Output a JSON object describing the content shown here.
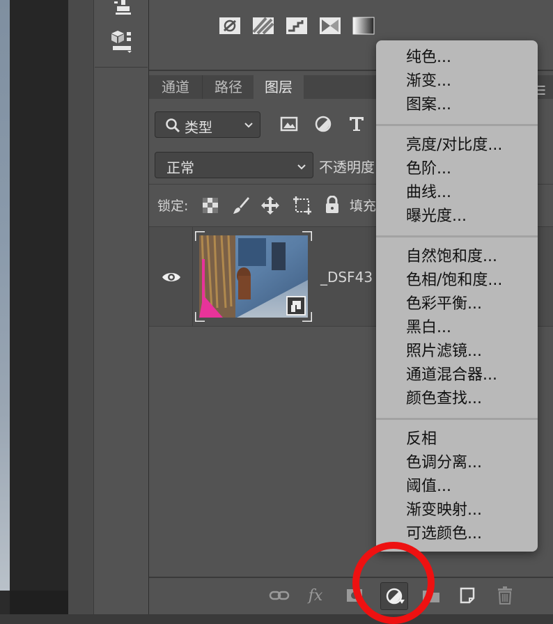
{
  "tabs": [
    {
      "label": "通道"
    },
    {
      "label": "路径"
    },
    {
      "label": "图层"
    }
  ],
  "filter": {
    "label": "类型"
  },
  "blend": {
    "mode": "正常",
    "opacity_label": "不透明度"
  },
  "lock": {
    "label": "锁定:",
    "fill_label": "填充"
  },
  "layer": {
    "name": "_DSF43"
  },
  "menu": {
    "group1": [
      "纯色...",
      "渐变...",
      "图案..."
    ],
    "group2": [
      "亮度/对比度...",
      "色阶...",
      "曲线...",
      "曝光度..."
    ],
    "group3": [
      "自然饱和度...",
      "色相/饱和度...",
      "色彩平衡...",
      "黑白...",
      "照片滤镜...",
      "通道混合器...",
      "颜色查找..."
    ],
    "group4": [
      "反相",
      "色调分离...",
      "阈值...",
      "渐变映射...",
      "可选颜色..."
    ]
  },
  "bottom_bar": {
    "fx_label": "fx"
  },
  "colors": {
    "panel": "#535353",
    "menu": "#b9b9b9",
    "annotation": "#ee1111"
  }
}
